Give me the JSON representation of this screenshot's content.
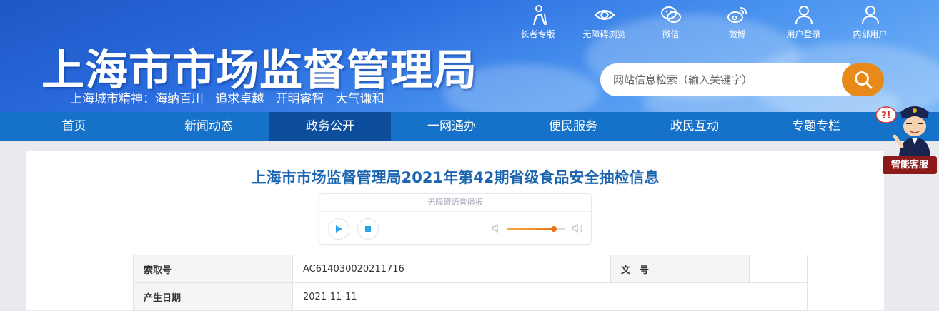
{
  "header": {
    "site_title": "上海市市场监督管理局",
    "slogan": "上海城市精神：海纳百川   追求卓越   开明睿智   大气谦和",
    "top_links": [
      {
        "label": "长者专版",
        "icon": "elder-icon"
      },
      {
        "label": "无障碍浏览",
        "icon": "eye-icon"
      },
      {
        "label": "微信",
        "icon": "wechat-icon"
      },
      {
        "label": "微博",
        "icon": "weibo-icon"
      },
      {
        "label": "用户登录",
        "icon": "user-icon"
      },
      {
        "label": "内部用户",
        "icon": "user-icon"
      }
    ],
    "search": {
      "placeholder": "网站信息检索（输入关键字）",
      "value": ""
    }
  },
  "nav": {
    "items": [
      "首页",
      "新闻动态",
      "政务公开",
      "一网通办",
      "便民服务",
      "政民互动",
      "专题专栏"
    ],
    "active_index": 2
  },
  "article": {
    "title": "上海市市场监督管理局2021年第42期省级食品安全抽检信息",
    "player": {
      "label": "无障碍语音播报",
      "volume": 0.8
    },
    "meta": [
      {
        "key": "索取号",
        "value": "AC614030020211716",
        "key2": "文　号",
        "value2": ""
      },
      {
        "key": "产生日期",
        "value": "2021-11-11"
      }
    ]
  },
  "assistant": {
    "label": "智能客服"
  },
  "colors": {
    "nav": "#1672c8",
    "nav_active": "#0c4e9c",
    "search_button": "#e88a1a",
    "title": "#1b64b0"
  }
}
